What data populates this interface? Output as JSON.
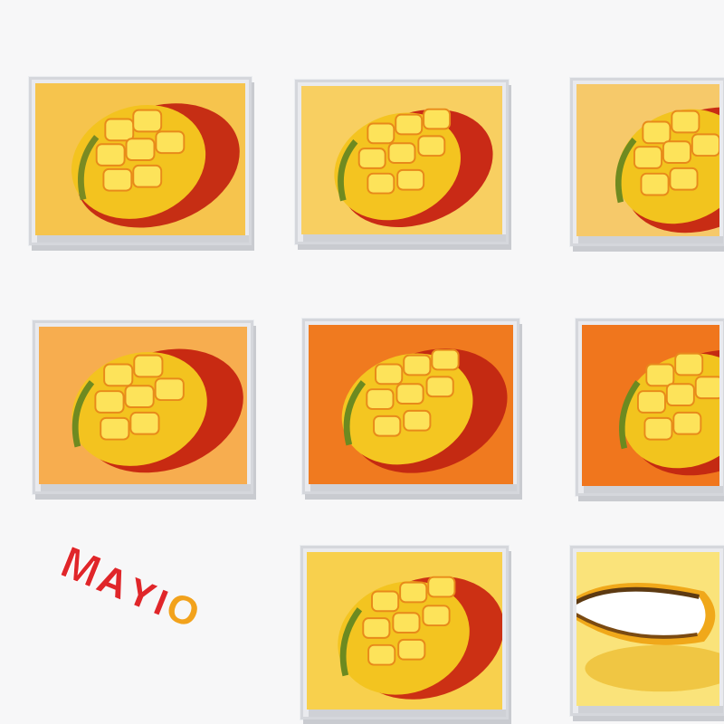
{
  "logo": {
    "text": "MAYIO",
    "colors": {
      "primary": "#e0262a",
      "accent": "#f2a21c"
    }
  },
  "tiles": [
    {
      "name": "mango-tile-1",
      "bg": "#f6c44d",
      "icon": "mango-hedgehog-icon"
    },
    {
      "name": "mango-tile-2",
      "bg": "#f8cf61",
      "icon": "mango-hedgehog-icon"
    },
    {
      "name": "mango-tile-3",
      "bg": "#f6c96a",
      "icon": "mango-hedgehog-icon"
    },
    {
      "name": "mango-tile-4",
      "bg": "#f7ad4f",
      "icon": "mango-hedgehog-icon"
    },
    {
      "name": "mango-tile-5",
      "bg": "#f07a1f",
      "icon": "mango-hedgehog-icon"
    },
    {
      "name": "mango-tile-6",
      "bg": "#f0761d",
      "icon": "mango-hedgehog-icon"
    },
    {
      "name": "mango-tile-7",
      "bg": "#f8d04d",
      "icon": "mango-hedgehog-icon"
    },
    {
      "name": "mango-tile-8",
      "bg": "#fae37a",
      "icon": "mango-half-icon"
    }
  ]
}
